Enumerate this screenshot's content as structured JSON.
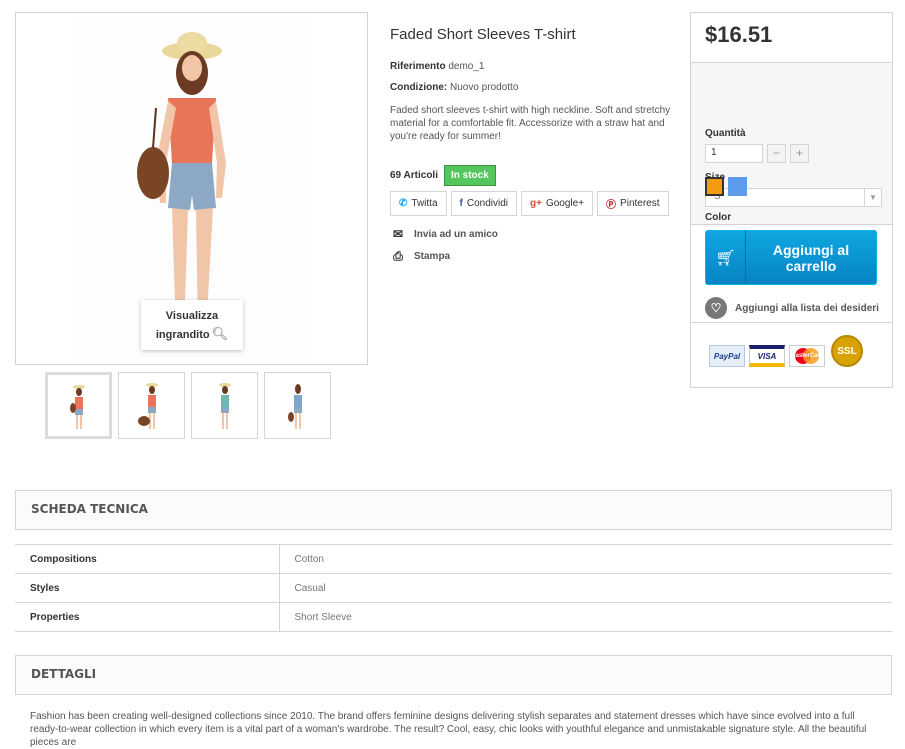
{
  "product": {
    "title": "Faded Short Sleeves T-shirt",
    "reference_label": "Riferimento",
    "reference_value": "demo_1",
    "condition_label": "Condizione:",
    "condition_value": "Nuovo prodotto",
    "description": "Faded short sleeves t-shirt with high neckline. Soft and stretchy material for a comfortable fit. Accessorize with a straw hat and you're ready for summer!",
    "stock_count": "69 Articoli",
    "stock_status": "In stock"
  },
  "gallery": {
    "zoom_label_line1": "Visualizza",
    "zoom_label_line2": "ingrandito"
  },
  "social": {
    "twitter": "Twitta",
    "facebook": "Condividi",
    "google": "Google+",
    "pinterest": "Pinterest"
  },
  "actions": {
    "send_friend": "Invia ad un amico",
    "print": "Stampa"
  },
  "buy": {
    "price": "$16.51",
    "quantity_label": "Quantità",
    "quantity_value": "1",
    "size_label": "Size",
    "size_value": "S",
    "color_label": "Color",
    "colors": [
      "#f39c11",
      "#5d9cec"
    ],
    "cart_label": "Aggiungi al carrello",
    "wishlist_label": "Aggiungi alla lista dei desideri",
    "payments": [
      "PayPal",
      "VISA",
      "MasterCard",
      "SSL"
    ]
  },
  "tech": {
    "heading": "Scheda tecnica",
    "rows": [
      {
        "key": "Compositions",
        "value": "Cotton"
      },
      {
        "key": "Styles",
        "value": "Casual"
      },
      {
        "key": "Properties",
        "value": "Short Sleeve"
      }
    ]
  },
  "details": {
    "heading": "Dettagli",
    "text": "Fashion has been creating well-designed collections since 2010. The brand offers feminine designs delivering stylish separates and statement dresses which have since evolved into a full ready-to-wear collection in which every item is a vital part of a woman's wardrobe. The result? Cool, easy, chic looks with youthful elegance and unmistakable signature style. All the beautiful pieces are"
  }
}
